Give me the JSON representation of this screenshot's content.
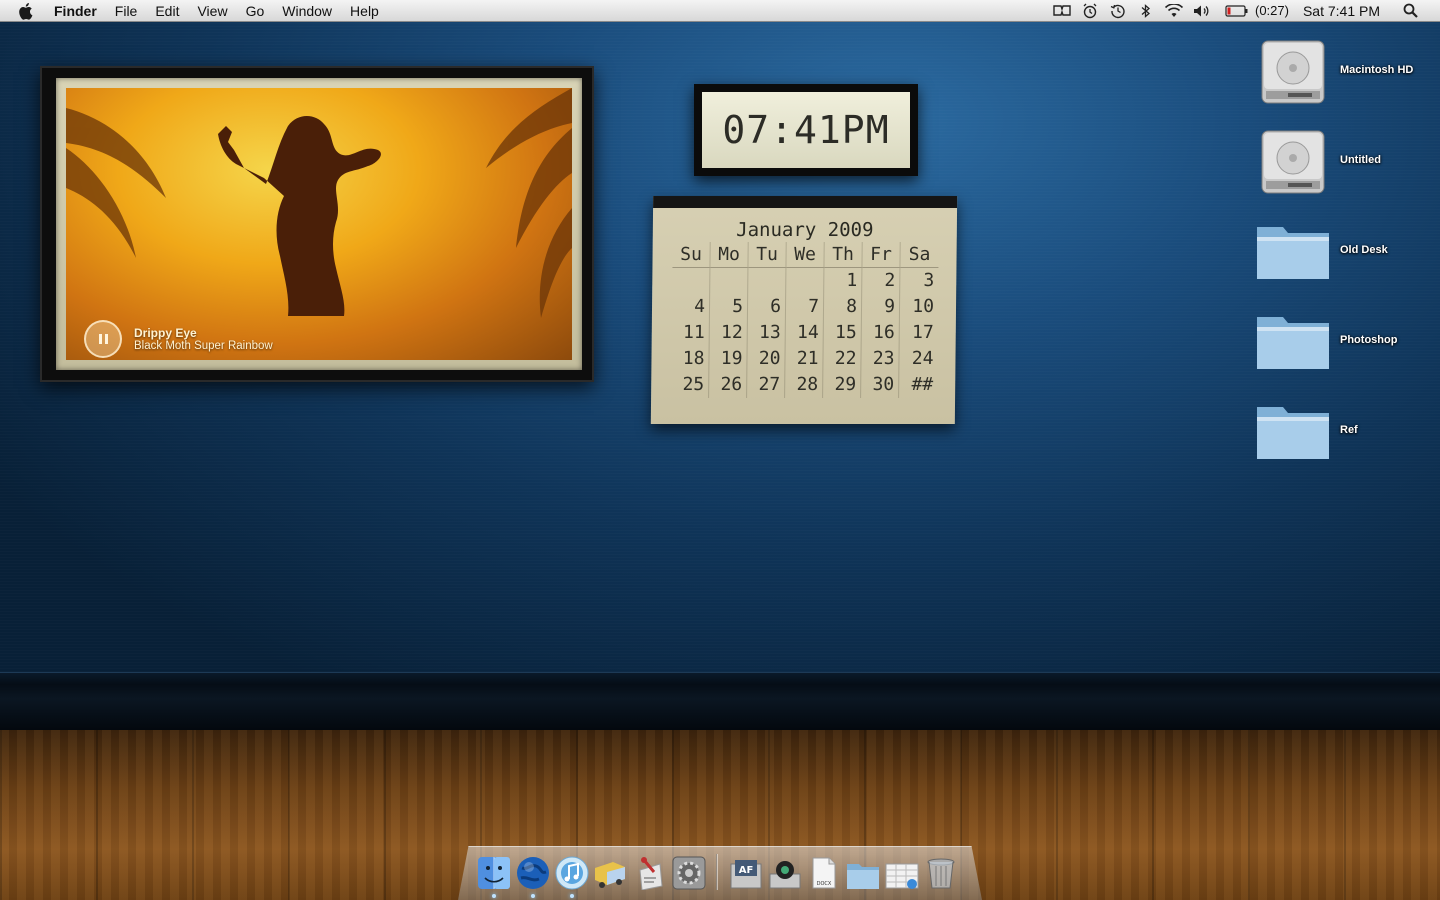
{
  "menubar": {
    "app_name": "Finder",
    "items": [
      "File",
      "Edit",
      "View",
      "Go",
      "Window",
      "Help"
    ],
    "status_icons": [
      "mirror-icon",
      "alarm-icon",
      "time-machine-icon",
      "bluetooth-icon",
      "wifi-icon",
      "volume-icon"
    ],
    "battery_time": "(0:27)",
    "clock": "Sat 7:41 PM"
  },
  "frame_widget": {
    "track_title": "Drippy Eye",
    "track_artist": "Black Moth Super Rainbow"
  },
  "clock_widget": {
    "time": "07:41PM"
  },
  "calendar": {
    "title": "January 2009",
    "weekdays": [
      "Su",
      "Mo",
      "Tu",
      "We",
      "Th",
      "Fr",
      "Sa"
    ],
    "weeks": [
      [
        "",
        "",
        "",
        "",
        "1",
        "2",
        "3"
      ],
      [
        "4",
        "5",
        "6",
        "7",
        "8",
        "9",
        "10"
      ],
      [
        "11",
        "12",
        "13",
        "14",
        "15",
        "16",
        "17"
      ],
      [
        "18",
        "19",
        "20",
        "21",
        "22",
        "23",
        "24"
      ],
      [
        "25",
        "26",
        "27",
        "28",
        "29",
        "30",
        "##"
      ]
    ]
  },
  "desktop_icons": [
    {
      "label": "Macintosh HD",
      "kind": "hard-drive"
    },
    {
      "label": "Untitled",
      "kind": "hard-drive"
    },
    {
      "label": "Old Desk",
      "kind": "folder"
    },
    {
      "label": "Photoshop",
      "kind": "folder"
    },
    {
      "label": "Ref",
      "kind": "folder"
    }
  ],
  "dock": {
    "apps": [
      "finder-icon",
      "network-globe-icon",
      "itunes-icon",
      "delivery-truck-icon",
      "script-editor-icon",
      "system-preferences-icon"
    ],
    "docs": [
      "af-app-icon",
      "disk-camera-icon",
      "docx-file-icon",
      "documents-folder-icon",
      "spreadsheet-icon",
      "trash-icon"
    ],
    "running": [
      "finder-icon",
      "network-globe-icon",
      "itunes-icon"
    ]
  },
  "colors": {
    "wall": "#0f3458",
    "floor": "#6a3f15",
    "menubar": "#e6e6e6"
  }
}
